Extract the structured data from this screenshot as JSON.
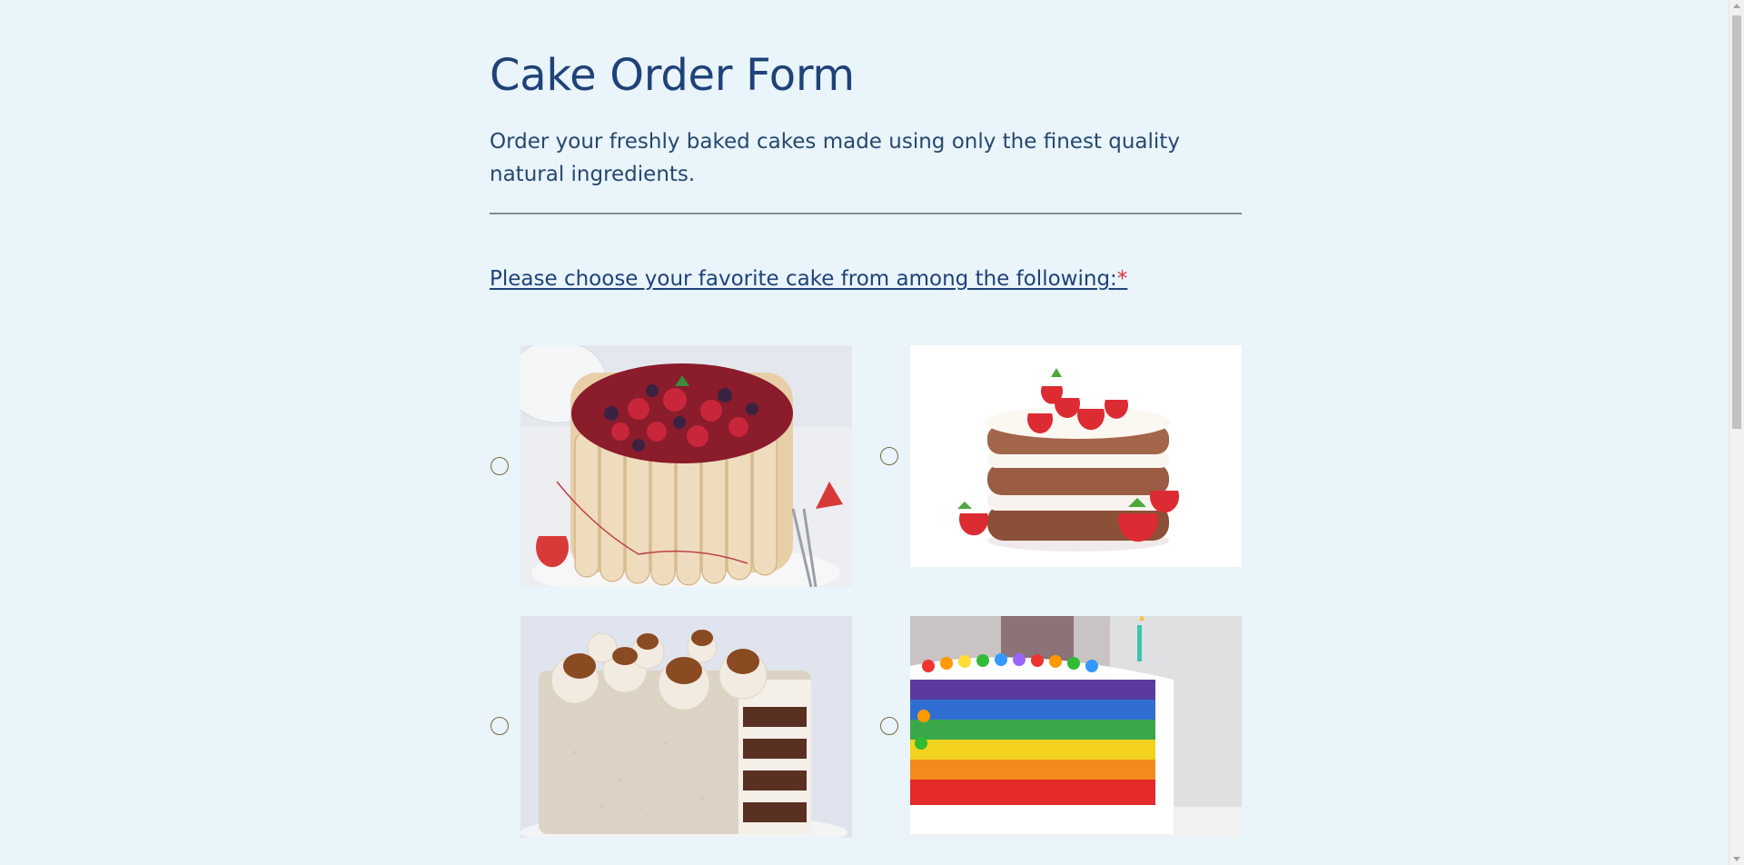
{
  "form": {
    "title": "Cake Order Form",
    "subtitle": "Order your freshly baked cakes made using only the finest quality natural ingredients.",
    "question": {
      "label": "Please choose your favorite cake from among the following:",
      "required_marker": "*"
    },
    "options": [
      {
        "name": "berry-charlotte-cake",
        "selected": false
      },
      {
        "name": "strawberry-layer-cake",
        "selected": false
      },
      {
        "name": "caramel-cream-cake",
        "selected": false
      },
      {
        "name": "rainbow-cake",
        "selected": false
      }
    ]
  },
  "colors": {
    "background": "#e9f4fb",
    "heading": "#1f4277",
    "required": "#e0313a",
    "radio_border": "#7b6b3e"
  }
}
